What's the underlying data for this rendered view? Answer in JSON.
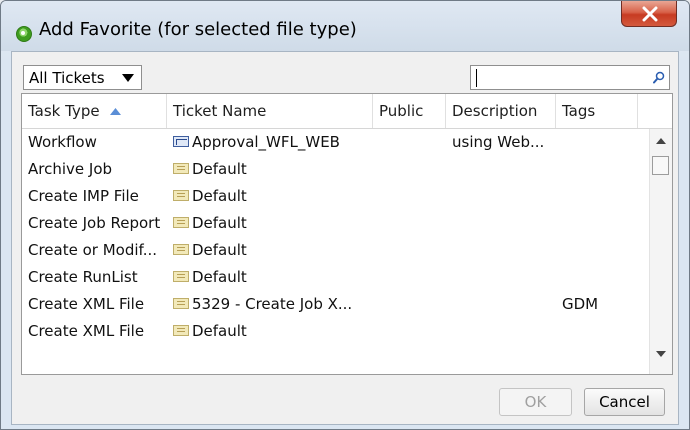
{
  "window": {
    "title": "Add Favorite (for selected file type)",
    "close_label": "X"
  },
  "toolbar": {
    "filter_value": "All Tickets",
    "search_value": ""
  },
  "table": {
    "columns": [
      "Task Type",
      "Ticket Name",
      "Public",
      "Description",
      "Tags"
    ],
    "sort_column": "Task Type",
    "sort_direction": "ascending",
    "rows": [
      {
        "task_type": "Workflow",
        "ticket_icon": "workflow-ticket-icon",
        "ticket_name": "Approval_WFL_WEB",
        "public": "",
        "description": "using Web...",
        "tags": ""
      },
      {
        "task_type": "Archive Job",
        "ticket_icon": "ticket-icon",
        "ticket_name": "Default",
        "public": "",
        "description": "",
        "tags": ""
      },
      {
        "task_type": "Create IMP File",
        "ticket_icon": "ticket-icon",
        "ticket_name": "Default",
        "public": "",
        "description": "",
        "tags": ""
      },
      {
        "task_type": "Create Job Report",
        "ticket_icon": "ticket-icon",
        "ticket_name": "Default",
        "public": "",
        "description": "",
        "tags": ""
      },
      {
        "task_type": "Create or Modif...",
        "ticket_icon": "ticket-icon",
        "ticket_name": "Default",
        "public": "",
        "description": "",
        "tags": ""
      },
      {
        "task_type": "Create RunList",
        "ticket_icon": "ticket-icon",
        "ticket_name": "Default",
        "public": "",
        "description": "",
        "tags": ""
      },
      {
        "task_type": "Create XML File",
        "ticket_icon": "ticket-icon",
        "ticket_name": "5329 - Create Job X...",
        "public": "",
        "description": "",
        "tags": "GDM"
      },
      {
        "task_type": "Create XML File",
        "ticket_icon": "ticket-icon",
        "ticket_name": "Default",
        "public": "",
        "description": "",
        "tags": ""
      }
    ]
  },
  "buttons": {
    "ok_label": "OK",
    "cancel_label": "Cancel",
    "ok_enabled": false
  }
}
